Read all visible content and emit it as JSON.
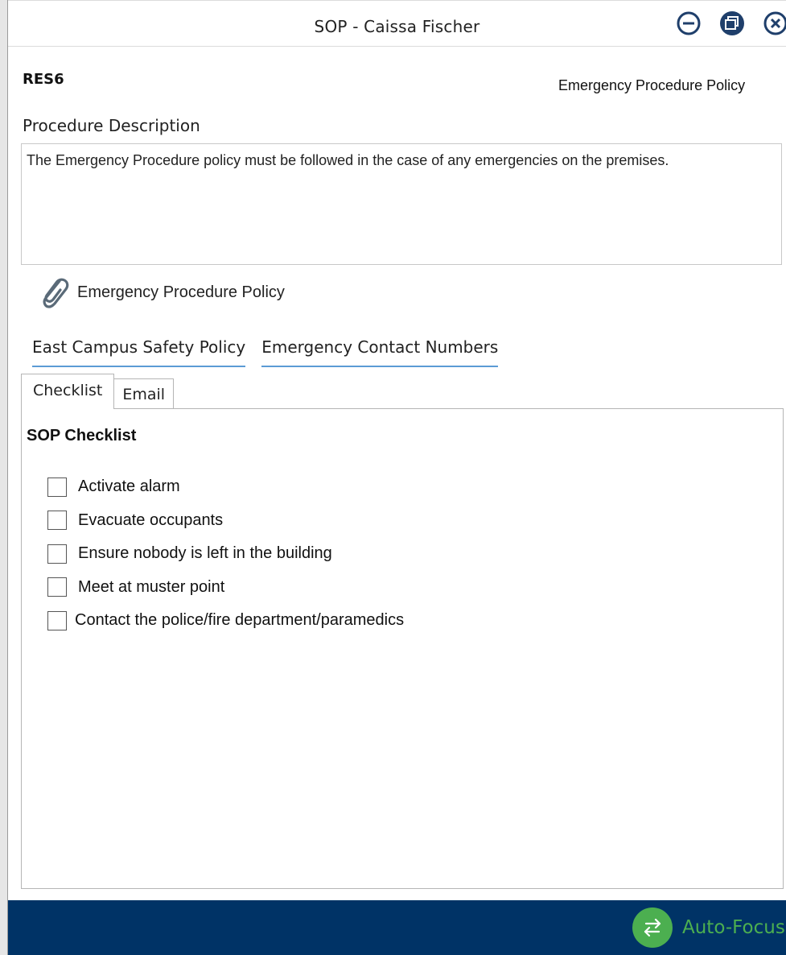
{
  "window": {
    "title": "SOP - Caissa Fischer",
    "controls": [
      "minimize-icon",
      "restore-icon",
      "close-icon"
    ]
  },
  "header": {
    "code": "RES6",
    "policy_name": "Emergency Procedure Policy"
  },
  "description": {
    "label": "Procedure Description",
    "text": "The Emergency Procedure policy must be followed in the case of any emergencies on the premises."
  },
  "attachment": {
    "icon": "paperclip-icon",
    "label": "Emergency Procedure Policy"
  },
  "related_links": [
    {
      "label": "East Campus Safety Policy"
    },
    {
      "label": "Emergency Contact Numbers"
    }
  ],
  "tabs": [
    {
      "label": "Checklist",
      "active": true
    },
    {
      "label": "Email",
      "active": false
    }
  ],
  "checklist": {
    "title": "SOP Checklist",
    "items": [
      {
        "label": "Activate alarm",
        "checked": false
      },
      {
        "label": "Evacuate occupants",
        "checked": false
      },
      {
        "label": "Ensure nobody is left in the building",
        "checked": false
      },
      {
        "label": "Meet at muster point",
        "checked": false
      },
      {
        "label": "Contact the police/fire department/paramedics",
        "checked": false
      }
    ]
  },
  "footer": {
    "button_label": "Auto-Focus",
    "icon": "swap-arrows-icon",
    "colors": {
      "bar": "#003366",
      "accent": "#4caf50"
    }
  }
}
